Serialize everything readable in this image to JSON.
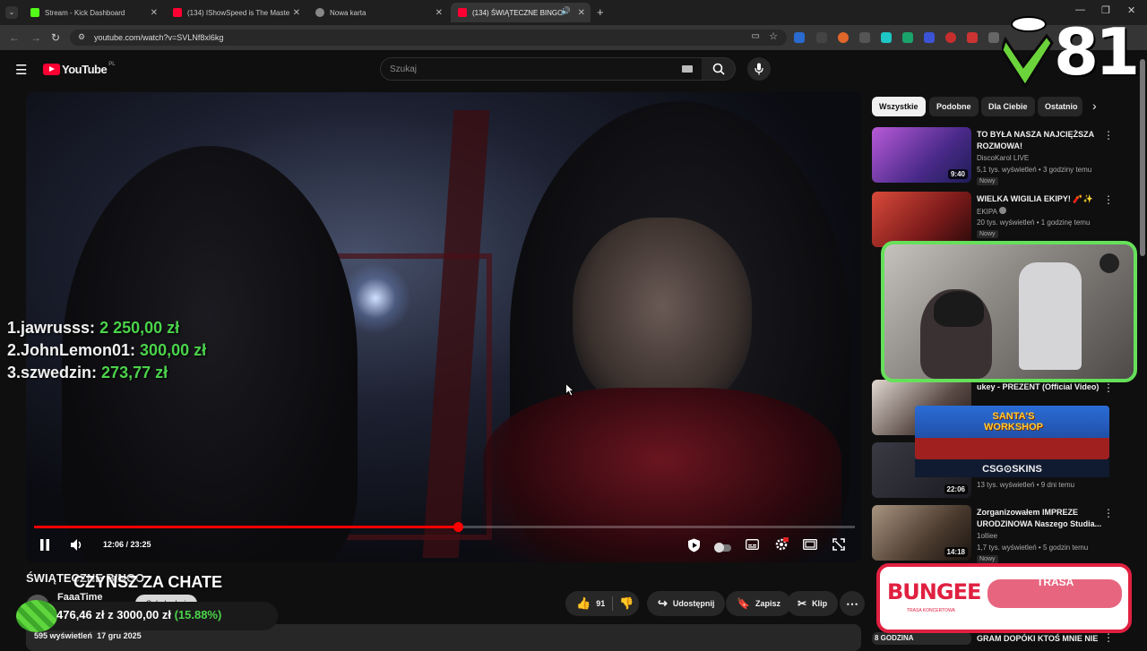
{
  "tabs": [
    {
      "label": "Stream - Kick Dashboard",
      "icon": "kick-icon",
      "color": "#53fc18"
    },
    {
      "label": "(134) IShowSpeed is The Maste",
      "icon": "youtube-icon",
      "color": "#ff0033"
    },
    {
      "label": "Nowa karta",
      "icon": "chrome-icon",
      "color": "#888888"
    },
    {
      "label": "(134) ŚWIĄTECZNE BINGO",
      "icon": "youtube-icon",
      "color": "#ff0033"
    }
  ],
  "address": {
    "url": "youtube.com/watch?v=SVLNf8xl6kg"
  },
  "youtube": {
    "logo": "YouTube",
    "region": "PL",
    "search_placeholder": "Szukaj"
  },
  "video": {
    "time": "12:06 / 23:25",
    "progress_fraction": 0.516,
    "leaderboard": [
      {
        "rank": "1.",
        "name": "jawrusss:",
        "amount": "2 250,00 zł"
      },
      {
        "rank": "2.",
        "name": "JohnLemon01:",
        "amount": "300,00 zł"
      },
      {
        "rank": "3.",
        "name": "szwedzin:",
        "amount": "273,77 zł"
      }
    ]
  },
  "below_video": {
    "title": "ŚWIĄTECZNE BINGO",
    "overlay_title": "CZYNSZ ZA CHATE",
    "channel": "FaaaTime",
    "subscribe": "Subskrybuj",
    "likes": "91",
    "share": "Udostępnij",
    "save": "Zapisz",
    "clip": "Klip",
    "views": "595 wyświetleń",
    "date": "17 gru 2025",
    "donation_text": "476,46 zł z 3000,00 zł",
    "donation_pct": "(15.88%)"
  },
  "chips": [
    "Wszystkie",
    "Podobne",
    "Dla Ciebie",
    "Ostatnio"
  ],
  "recommendations": [
    {
      "title": "TO BYŁA NASZA NAJCIĘŻSZA ROZMOWA!",
      "channel": "DiscoKarol LIVE",
      "meta": "5,1 tys. wyświetleń • 3 godziny temu",
      "badge": "Nowy",
      "duration": "9:40",
      "thumb": "#8a4fb8"
    },
    {
      "title": "WIELKA WIGILIA EKIPY! 🧨✨",
      "channel": "EKIPA",
      "meta": "20 tys. wyświetleń • 1 godzinę temu",
      "badge": "Nowy",
      "duration": "",
      "thumb": "#a8322c"
    },
    {
      "title": "ukey - PREZENT (Official Video)",
      "channel": "",
      "meta": "",
      "badge": "",
      "duration": "",
      "thumb": "#6a6a6a"
    },
    {
      "title": "",
      "channel": "",
      "meta": "13 tys. wyświetleń • 9 dni temu",
      "badge": "",
      "duration": "22:06",
      "thumb": "#2d2d33"
    },
    {
      "title": "Zorganizowałem IMPREZE URODZINOWA Naszego Studia...",
      "channel": "1olliee",
      "meta": "1,7 tys. wyświetleń • 5 godzin temu",
      "badge": "Nowy",
      "duration": "14:18",
      "thumb": "#7a6a5a"
    },
    {
      "title": "GRAM DOPÓKI KTOŚ MNIE NIE",
      "channel": "",
      "meta": "",
      "badge": "",
      "duration": "",
      "thumb": "#3a3a3a"
    }
  ],
  "overlays": {
    "counter": "81",
    "sponsor": "CSG⊙SKINS",
    "banner_label": "SANTA'S WORKSHOP",
    "bungee": "BUNGEE",
    "bungee_sub": "TRASA KONCERTOWA",
    "bungee_right": "TRASA",
    "thumb_label": "8 GODZINA"
  }
}
